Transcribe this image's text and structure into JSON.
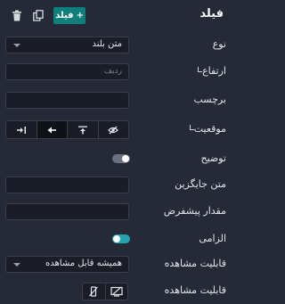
{
  "header": {
    "title": "فیلد",
    "add_button_label": "فیلد",
    "add_button_plus": "+"
  },
  "rows": {
    "type": {
      "label": "نوع",
      "value": "متن بلند"
    },
    "height": {
      "label": "ارتفاع",
      "placeholder": "ردیف"
    },
    "tag": {
      "label": "برچسب",
      "value": ""
    },
    "position": {
      "label": "موقعیت"
    },
    "description": {
      "label": "توضیح",
      "toggle_on": false
    },
    "placeholder_text": {
      "label": "متن جایگزین",
      "value": ""
    },
    "default_value": {
      "label": "مقدار پیشفرض",
      "value": ""
    },
    "required": {
      "label": "الزامی",
      "toggle_on": true
    },
    "visibility": {
      "label": "قابلیت مشاهده",
      "value": "همیشه قابل مشاهده"
    },
    "visibility_devices": {
      "label": "قابلیت مشاهده"
    }
  },
  "colors": {
    "background": "#262a36",
    "input_background": "#1a1d26",
    "accent": "#0e7f7b",
    "toggle_on": "#1fa6b0",
    "toggle_off": "#6b7080"
  }
}
